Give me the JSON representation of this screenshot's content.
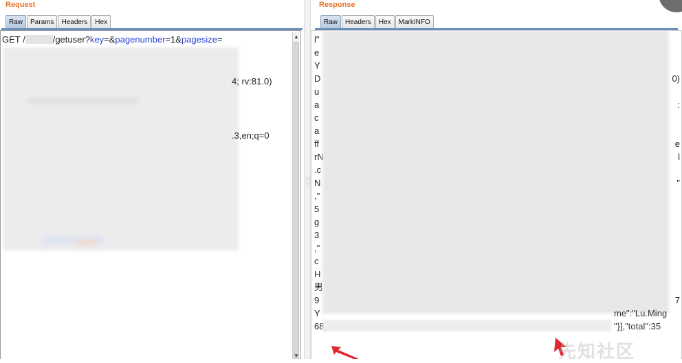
{
  "request": {
    "title": "Request",
    "tabs": [
      "Raw",
      "Params",
      "Headers",
      "Hex"
    ],
    "active_tab": "Raw",
    "first_line": {
      "method_path": "GET /",
      "path_tail": "/getuser?",
      "p1": "key",
      "eq_amp1": "=&",
      "p2": "pagenumber",
      "v2": "=1&",
      "p3": "pagesize",
      "v3": "="
    },
    "fragments": {
      "ua_tail": "4; rv:81.0)",
      "lang_tail": ".3,en;q=0"
    }
  },
  "response": {
    "title": "Response",
    "tabs": [
      "Raw",
      "Headers",
      "Hex",
      "MarkINFO"
    ],
    "active_tab": "Raw",
    "left_chars": [
      "l\"",
      "e",
      "Y",
      "D",
      "u",
      "a",
      "c",
      "a",
      "ff",
      "rN",
      ".c",
      "N",
      ",\"",
      "5",
      "g",
      "3",
      ",\"",
      "c",
      "H",
      "男",
      "9",
      "Y",
      "68}"
    ],
    "right_chars": [
      "",
      "",
      "",
      "0)",
      "",
      ":",
      "",
      "",
      "e",
      "l",
      "",
      "\"",
      "",
      "",
      "",
      "",
      "",
      "",
      "",
      "",
      "7",
      "",
      ""
    ],
    "tail_line1": "me\":\"Lu.Ming",
    "tail_line2": "\"}],\"total\":35",
    "tail_line3": "68}"
  },
  "watermark": "先知社区",
  "colors": {
    "title": "#e8752d",
    "param": "#2b45d6",
    "arrow": "#e0292e"
  }
}
